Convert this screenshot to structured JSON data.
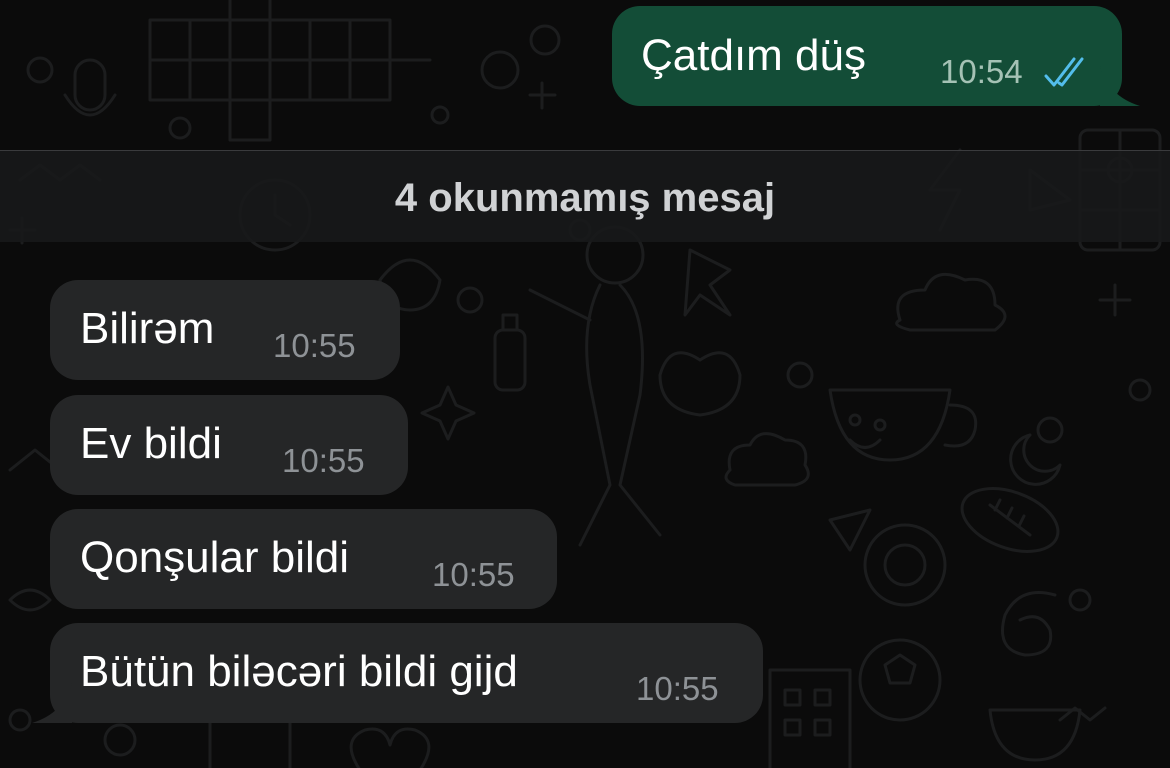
{
  "chat": {
    "outgoing": {
      "text": "Çatdım düş",
      "time": "10:54",
      "status": "read",
      "status_icon": "double-check-icon",
      "tick_color": "#53bdeb"
    },
    "unread_divider": {
      "label": "4 okunmamış mesaj"
    },
    "incoming": [
      {
        "text": "Bilirəm",
        "time": "10:55"
      },
      {
        "text": "Ev bildi",
        "time": "10:55"
      },
      {
        "text": "Qonşular bildi",
        "time": "10:55"
      },
      {
        "text": "Bütün biləcəri bildi gijd",
        "time": "10:55"
      }
    ]
  },
  "colors": {
    "background": "#0b0b0b",
    "incoming_bubble": "#252627",
    "outgoing_bubble": "#134d37",
    "timestamp_incoming": "#8e9296",
    "timestamp_outgoing": "#a5c2b5",
    "read_ticks": "#53bdeb"
  }
}
